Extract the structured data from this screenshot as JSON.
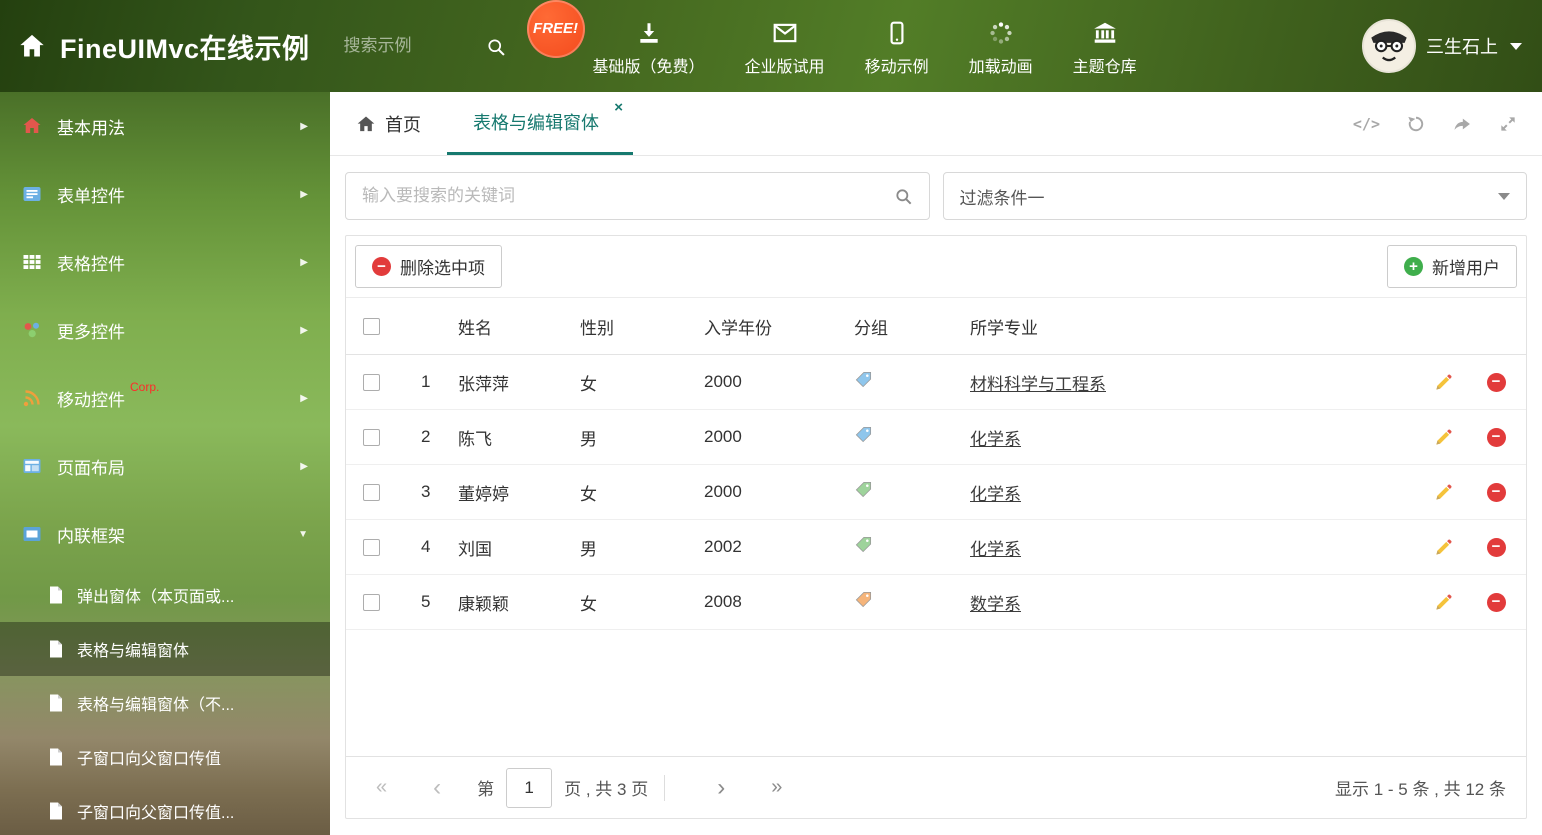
{
  "colors": {
    "accent": "#17796f",
    "danger": "#e23b3b",
    "success": "#3fae4c",
    "free_badge": "#f34a1d",
    "corp_badge": "#ff2a2a"
  },
  "header": {
    "title": "FineUIMvc在线示例",
    "search_placeholder": "搜索示例",
    "free_badge": "FREE!",
    "nav_items": [
      {
        "label": "基础版（免费）",
        "icon": "download-icon"
      },
      {
        "label": "企业版试用",
        "icon": "envelope-icon"
      },
      {
        "label": "移动示例",
        "icon": "mobile-icon"
      },
      {
        "label": "加载动画",
        "icon": "spinner-icon"
      },
      {
        "label": "主题仓库",
        "icon": "bank-icon"
      }
    ],
    "user_name": "三生石上"
  },
  "sidebar": {
    "items": [
      {
        "label": "基本用法"
      },
      {
        "label": "表单控件"
      },
      {
        "label": "表格控件"
      },
      {
        "label": "更多控件"
      },
      {
        "label": "移动控件",
        "badge": "Corp."
      },
      {
        "label": "页面布局"
      },
      {
        "label": "内联框架"
      }
    ],
    "subitems": [
      {
        "label": "弹出窗体（本页面或..."
      },
      {
        "label": "表格与编辑窗体"
      },
      {
        "label": "表格与编辑窗体（不..."
      },
      {
        "label": "子窗口向父窗口传值"
      },
      {
        "label": "子窗口向父窗口传值..."
      }
    ]
  },
  "tabs": {
    "items": [
      {
        "label": "首页"
      },
      {
        "label": "表格与编辑窗体"
      }
    ]
  },
  "filters": {
    "search_placeholder": "输入要搜索的关键词",
    "filter_selected": "过滤条件一"
  },
  "toolbar": {
    "delete_label": "删除选中项",
    "add_label": "新增用户"
  },
  "table": {
    "headers": [
      "姓名",
      "性别",
      "入学年份",
      "分组",
      "所学专业"
    ],
    "rows": [
      {
        "num": "1",
        "name": "张萍萍",
        "gender": "女",
        "year": "2000",
        "tag_color": "#8fc6ec",
        "major": "材料科学与工程系"
      },
      {
        "num": "2",
        "name": "陈飞",
        "gender": "男",
        "year": "2000",
        "tag_color": "#8fc6ec",
        "major": "化学系"
      },
      {
        "num": "3",
        "name": "董婷婷",
        "gender": "女",
        "year": "2000",
        "tag_color": "#9ed39b",
        "major": "化学系"
      },
      {
        "num": "4",
        "name": "刘国",
        "gender": "男",
        "year": "2002",
        "tag_color": "#9ed39b",
        "major": "化学系"
      },
      {
        "num": "5",
        "name": "康颖颖",
        "gender": "女",
        "year": "2008",
        "tag_color": "#f5b47a",
        "major": "数学系"
      }
    ]
  },
  "pagination": {
    "page_prefix": "第",
    "current_page": "1",
    "page_suffix": "页 , 共 3 页",
    "summary": "显示 1 - 5 条 , 共 12 条"
  }
}
